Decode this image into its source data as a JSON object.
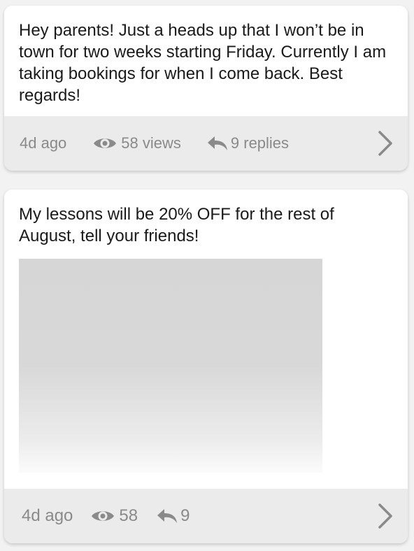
{
  "posts": [
    {
      "text": "Hey parents! Just a heads up that I won’t be in town for two weeks starting Friday. Currently I am taking bookings for when I come back. Best regards!",
      "age": "4d ago",
      "views": "58 views",
      "replies": "9 replies",
      "has_image": false
    },
    {
      "text": "My lessons will be 20% OFF for the rest of August, tell your friends!",
      "age": "4d ago",
      "views": "58",
      "replies": "9",
      "has_image": true
    }
  ],
  "icons": {
    "views": "eye-icon",
    "replies": "reply-icon",
    "open": "chevron-right-icon"
  },
  "colors": {
    "card_background": "#ffffff",
    "footer_background": "#ebebeb",
    "meta_text": "#8a8a8a",
    "body_text": "#1a1a1a",
    "image_placeholder": "#d6d6d6"
  }
}
